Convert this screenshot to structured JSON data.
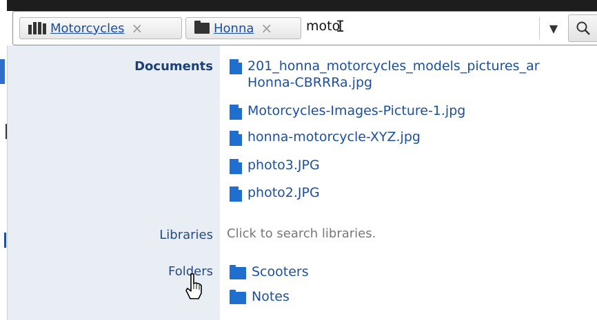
{
  "search": {
    "filters": [
      {
        "label": "Motorcycles",
        "icon": "library-icon"
      },
      {
        "label": "Honna",
        "icon": "folder-icon"
      }
    ],
    "remove_glyph": "×",
    "query": "moto",
    "dropdown_glyph": "▼"
  },
  "suggestions": {
    "documents": {
      "heading": "Documents",
      "items": [
        {
          "line1": "201_honna_motorcycles_models_pictures_ar",
          "line2": "Honna-CBRRRa.jpg"
        },
        {
          "line1": "Motorcycles-Images-Picture-1.jpg"
        },
        {
          "line1": "honna-motorcycle-XYZ.jpg"
        },
        {
          "line1": "photo3.JPG"
        },
        {
          "line1": "photo2.JPG"
        }
      ]
    },
    "libraries": {
      "heading": "Libraries",
      "hint": "Click to search libraries."
    },
    "folders": {
      "heading": "Folders",
      "items": [
        "Scooters",
        "Notes"
      ]
    }
  },
  "colors": {
    "link": "#1a4fa3",
    "icon_blue": "#1f6fd0",
    "category_bg": "#e9eef4"
  }
}
